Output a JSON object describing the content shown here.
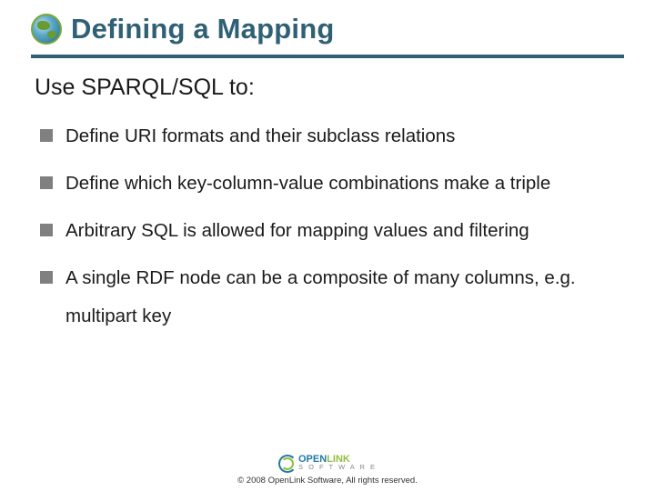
{
  "title": "Defining a Mapping",
  "subtitle": "Use SPARQL/SQL to:",
  "bullets": [
    "Define URI formats and their subclass relations",
    "Define which key-column-value combinations make a triple",
    "Arbitrary SQL is allowed for mapping values and filtering",
    "A single RDF node can be a composite of many columns, e.g. multipart key"
  ],
  "footer": {
    "logo_main": "OPEN",
    "logo_accent": "LINK",
    "logo_sub": "S O F T W A R E",
    "copyright": "© 2008 OpenLink Software, All rights reserved."
  }
}
